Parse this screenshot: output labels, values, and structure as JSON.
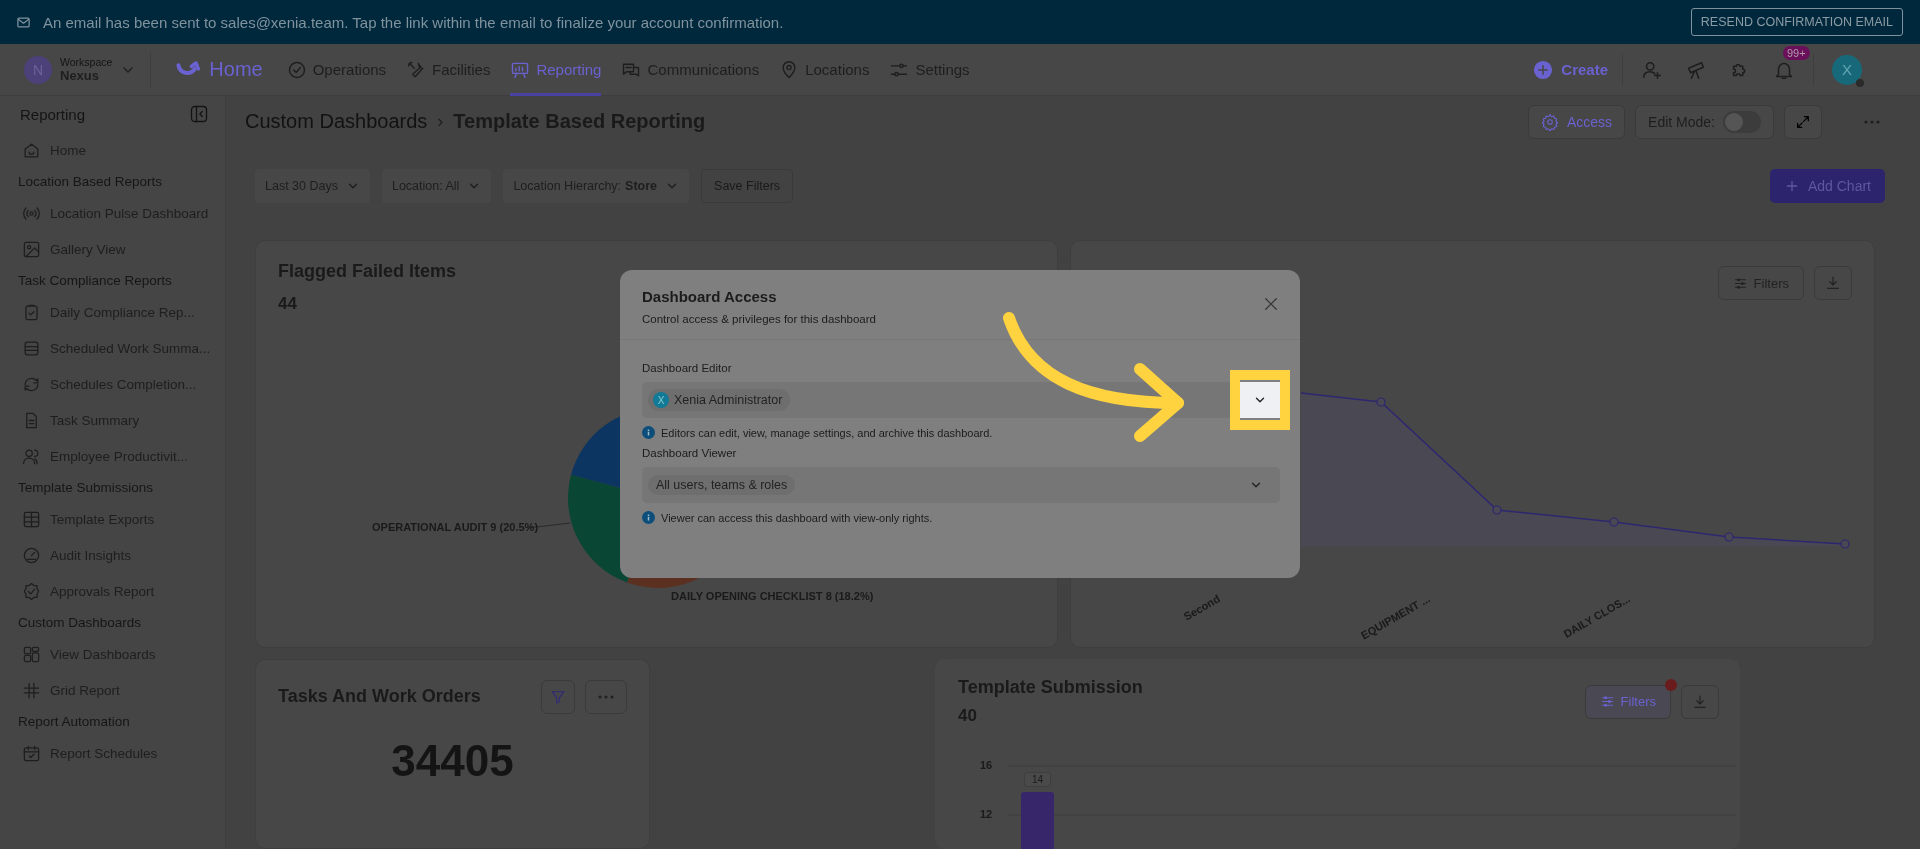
{
  "banner": {
    "message": "An email has been sent to sales@xenia.team. Tap the link within the email to finalize your account confirmation.",
    "button": "RESEND CONFIRMATION EMAIL"
  },
  "nav": {
    "workspace": {
      "initial": "N",
      "label": "Workspace",
      "name": "Nexus"
    },
    "home": "Home",
    "items": [
      {
        "label": "Operations",
        "selected": false
      },
      {
        "label": "Facilities",
        "selected": false
      },
      {
        "label": "Reporting",
        "selected": true
      },
      {
        "label": "Communications",
        "selected": false
      },
      {
        "label": "Locations",
        "selected": false
      },
      {
        "label": "Settings",
        "selected": false
      }
    ],
    "create": "Create",
    "badge": "99+",
    "avatar": "X"
  },
  "sidebar": {
    "title": "Reporting",
    "items": [
      {
        "kind": "link",
        "label": "Home"
      },
      {
        "kind": "section",
        "label": "Location Based Reports"
      },
      {
        "kind": "link",
        "label": "Location Pulse Dashboard"
      },
      {
        "kind": "link",
        "label": "Gallery View"
      },
      {
        "kind": "section",
        "label": "Task Compliance Reports"
      },
      {
        "kind": "link",
        "label": "Daily Compliance Rep..."
      },
      {
        "kind": "link",
        "label": "Scheduled Work Summa..."
      },
      {
        "kind": "link",
        "label": "Schedules Completion..."
      },
      {
        "kind": "link",
        "label": "Task Summary"
      },
      {
        "kind": "link",
        "label": "Employee Productivit..."
      },
      {
        "kind": "section",
        "label": "Template Submissions"
      },
      {
        "kind": "link",
        "label": "Template Exports"
      },
      {
        "kind": "link",
        "label": "Audit Insights"
      },
      {
        "kind": "link",
        "label": "Approvals Report"
      },
      {
        "kind": "section",
        "label": "Custom Dashboards"
      },
      {
        "kind": "link",
        "label": "View Dashboards"
      },
      {
        "kind": "link",
        "label": "Grid Report"
      },
      {
        "kind": "section",
        "label": "Report Automation"
      },
      {
        "kind": "link",
        "label": "Report Schedules"
      }
    ]
  },
  "header": {
    "breadcrumb": "Custom Dashboards",
    "separator": "›",
    "title": "Template Based Reporting",
    "access": "Access",
    "edit_mode": {
      "label": "Edit Mode:",
      "on": false
    }
  },
  "filters": [
    {
      "label": "Last 30 Days"
    },
    {
      "label": "Location: All"
    },
    {
      "label": "Location Hierarchy:",
      "value": "Store"
    }
  ],
  "save_filters": {
    "label": "Save Filters",
    "disabled": true
  },
  "add_chart": "Add Chart",
  "flagged": {
    "title": "Flagged Failed Items",
    "count": "44",
    "labels": [
      "OPERATIONAL AUDIT 9 (20.5%)",
      "DAILY OPENING CHECKLIST 8 (18.2%)"
    ]
  },
  "trend": {
    "filters": "Filters",
    "x_labels": [
      "Second",
      "EQUIPMENT ...",
      "DAILY CLOS..."
    ]
  },
  "tasks": {
    "title": "Tasks And Work Orders",
    "value": "34405"
  },
  "submission": {
    "title": "Template Submission",
    "count": "40",
    "filters": "Filters",
    "y_ticks": [
      "16",
      "12"
    ],
    "bar_label": "14"
  },
  "modal": {
    "title": "Dashboard Access",
    "subtitle": "Control access & privileges for this dashboard",
    "fields": [
      {
        "label": "Dashboard Editor",
        "chip_avatar": "X",
        "chip": "Xenia Administrator",
        "info": "Editors can edit, view, manage settings, and archive this dashboard.",
        "highlighted": true
      },
      {
        "label": "Dashboard Viewer",
        "chip": "All users, teams & roles",
        "info": "Viewer can access this dashboard with view-only rights.",
        "highlighted": false
      }
    ]
  }
}
